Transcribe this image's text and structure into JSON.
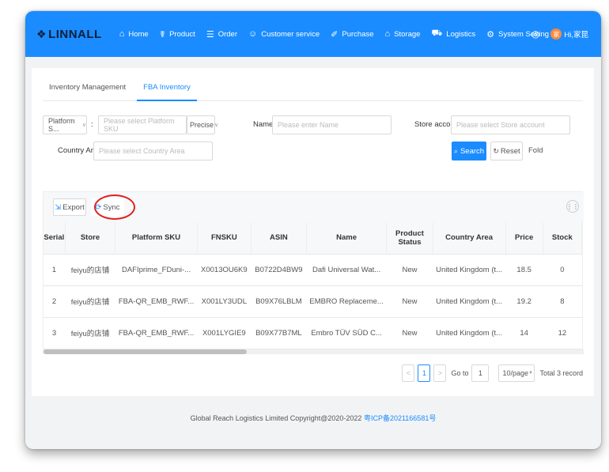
{
  "brand": {
    "logo_mark": "❖",
    "name": "LINNALL"
  },
  "nav": {
    "items": [
      {
        "icon": "⌂",
        "label": "Home"
      },
      {
        "icon": "☤",
        "label": "Product"
      },
      {
        "icon": "☰",
        "label": "Order"
      },
      {
        "icon": "☺",
        "label": "Customer service"
      },
      {
        "icon": "✐",
        "label": "Purchase"
      },
      {
        "icon": "⌂",
        "label": "Storage"
      },
      {
        "icon": "⛟",
        "label": "Logistics"
      },
      {
        "icon": "⚙",
        "label": "System Setting"
      }
    ],
    "globe_icon": "◎",
    "avatar_char": "家",
    "user_greeting": "Hi,家昆"
  },
  "tabs": [
    {
      "label": "Inventory Management",
      "active": false
    },
    {
      "label": "FBA Inventory",
      "active": true
    }
  ],
  "filters": {
    "platform_select": "Platform S...",
    "platform_sku_placeholder": "Please select Platform SKU",
    "match_mode": "Precise",
    "name_label": "Name:",
    "name_placeholder": "Please enter Name",
    "store_account_label": "Store account:",
    "store_account_placeholder": "Please select Store account",
    "country_area_label": "Country Area:",
    "country_area_placeholder": "Please select Country Area",
    "search_label": "Search",
    "reset_label": "Reset",
    "fold_label": "Fold"
  },
  "toolbar": {
    "export_label": "Export",
    "sync_label": "Sync"
  },
  "table": {
    "columns": [
      "Serial",
      "Store",
      "Platform SKU",
      "FNSKU",
      "ASIN",
      "Name",
      "Product Status",
      "Country Area",
      "Price",
      "Stock"
    ],
    "rows": [
      [
        "1",
        "feiyu的店铺",
        "DAFIprime_FDuni-...",
        "X0013OU6K9",
        "B0722D4BW9",
        "Dafi Universal Wat...",
        "New",
        "United Kingdom (t...",
        "18.5",
        "0"
      ],
      [
        "2",
        "feiyu的店铺",
        "FBA-QR_EMB_RWF...",
        "X001LY3UDL",
        "B09X76LBLM",
        "EMBRO Replaceme...",
        "New",
        "United Kingdom (t...",
        "19.2",
        "8"
      ],
      [
        "3",
        "feiyu的店铺",
        "FBA-QR_EMB_RWF...",
        "X001LYGIE9",
        "B09X77B7ML",
        "Embro TÜV SÜD C...",
        "New",
        "United Kingdom (t...",
        "14",
        "12"
      ]
    ]
  },
  "pagination": {
    "prev": "<",
    "current_page": "1",
    "next": ">",
    "goto_label": "Go to",
    "goto_value": "1",
    "page_size": "10/page",
    "total": "Total 3 record"
  },
  "footer": {
    "text": "Global Reach Logistics Limited Copyright@2020-2022",
    "icp": "粤ICP备2021166581号"
  }
}
